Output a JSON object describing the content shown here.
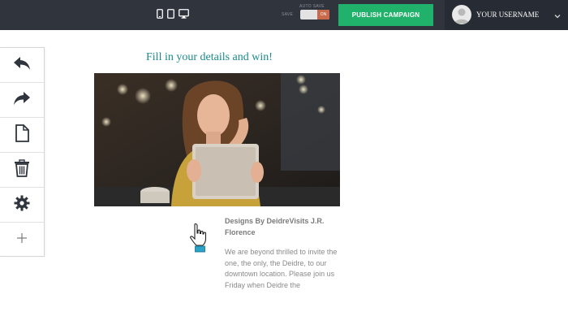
{
  "topbar": {
    "devices": [
      {
        "icon": "mobile-icon"
      },
      {
        "icon": "tablet-icon"
      },
      {
        "icon": "desktop-icon"
      }
    ],
    "save_label": "SAVE",
    "autosave_label": "AUTO SAVE",
    "autosave_state": "ON",
    "publish_label": "PUBLISH CAMPAIGN",
    "username": "YOUR USERNAME",
    "colors": {
      "bar": "#2f343d",
      "publish": "#20b26b",
      "toggle_on": "#c86a4b"
    }
  },
  "toolbar": {
    "tools": [
      {
        "icon": "undo-icon"
      },
      {
        "icon": "redo-icon"
      },
      {
        "icon": "page-icon"
      },
      {
        "icon": "trash-icon"
      },
      {
        "icon": "gear-icon"
      },
      {
        "icon": "plus-icon"
      }
    ]
  },
  "content": {
    "headline": "Fill in your details and win!",
    "hero_image": "woman-with-tablet-photo",
    "card_title": "Designs By DeidreVisits J.R. Florence",
    "card_body": "We are beyond thrilled to invite the one, the only, the Deidre, to our downtown location. Please join us Friday when Deidre the",
    "colors": {
      "headline": "#1a8a8a",
      "cursor_cuff": "#2aa3c9"
    }
  }
}
